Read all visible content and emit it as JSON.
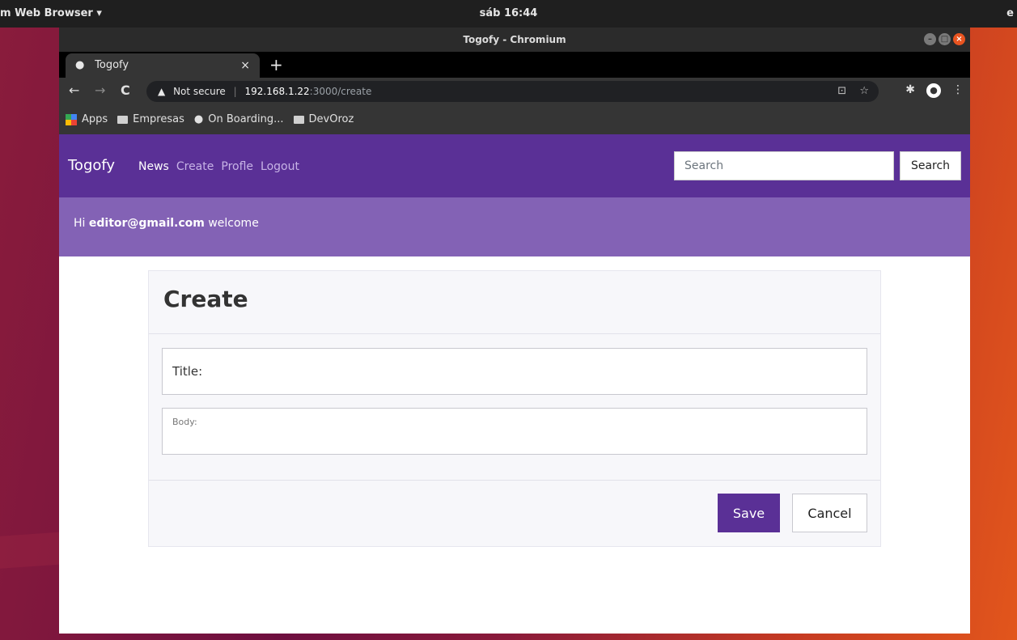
{
  "desktop": {
    "app_menu": "m Web Browser ▾",
    "clock": "sáb 16:44",
    "right_edge": "e"
  },
  "browser": {
    "window_title": "Togofy - Chromium",
    "tab": {
      "title": "Togofy",
      "close": "×"
    },
    "new_tab": "+",
    "omnibox": {
      "security": "Not secure",
      "host": "192.168.1.22",
      "path": ":3000/create"
    },
    "bookmarks": [
      {
        "label": "Apps",
        "icon": "apps-grid-icon"
      },
      {
        "label": "Empresas",
        "icon": "folder-icon"
      },
      {
        "label": "On Boarding...",
        "icon": "globe-icon"
      },
      {
        "label": "DevOroz",
        "icon": "folder-icon"
      }
    ]
  },
  "navbar": {
    "brand": "Togofy",
    "links": [
      {
        "label": "News"
      },
      {
        "label": "Create"
      },
      {
        "label": "Profle"
      },
      {
        "label": "Logout"
      }
    ],
    "search_placeholder": "Search",
    "search_button": "Search"
  },
  "welcome": {
    "prefix": "Hi",
    "email": "editor@gmail.com",
    "suffix": "welcome"
  },
  "form": {
    "heading": "Create",
    "title_placeholder": "Title:",
    "body_placeholder": "Body:",
    "save_label": "Save",
    "cancel_label": "Cancel"
  },
  "colors": {
    "navbar": "#5a3096",
    "welcome_bar": "#8362b5",
    "save_button": "#5a3096"
  }
}
